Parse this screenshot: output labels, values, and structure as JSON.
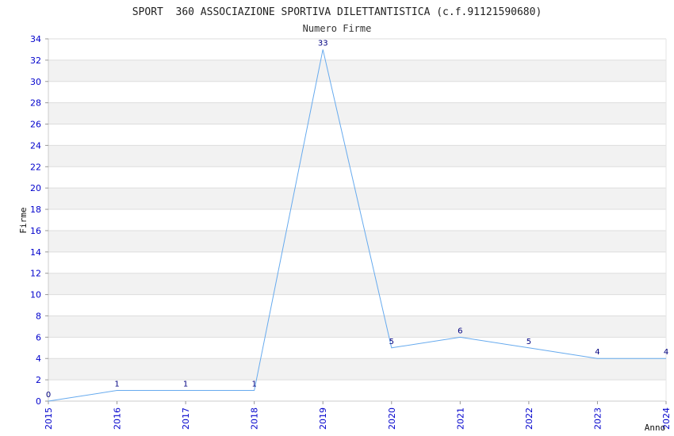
{
  "chart_data": {
    "type": "line",
    "title": "SPORT  360 ASSOCIAZIONE SPORTIVA DILETTANTISTICA (c.f.91121590680)",
    "subtitle": "Numero Firme",
    "xlabel": "Anno",
    "ylabel": "Firme",
    "x": [
      "2015",
      "2016",
      "2017",
      "2018",
      "2019",
      "2020",
      "2021",
      "2022",
      "2023",
      "2024"
    ],
    "values": [
      0,
      1,
      1,
      1,
      33,
      5,
      6,
      5,
      4,
      4
    ],
    "ylim": [
      0,
      34
    ],
    "yticks": [
      0,
      2,
      4,
      6,
      8,
      10,
      12,
      14,
      16,
      18,
      20,
      22,
      24,
      26,
      28,
      30,
      32,
      34
    ],
    "grid": true,
    "legend": "none",
    "colors": {
      "line": "#66aaee",
      "band": "#f2f2f2",
      "grid": "#dddddd",
      "tick_label": "#0000cc",
      "data_label": "#000080"
    }
  }
}
